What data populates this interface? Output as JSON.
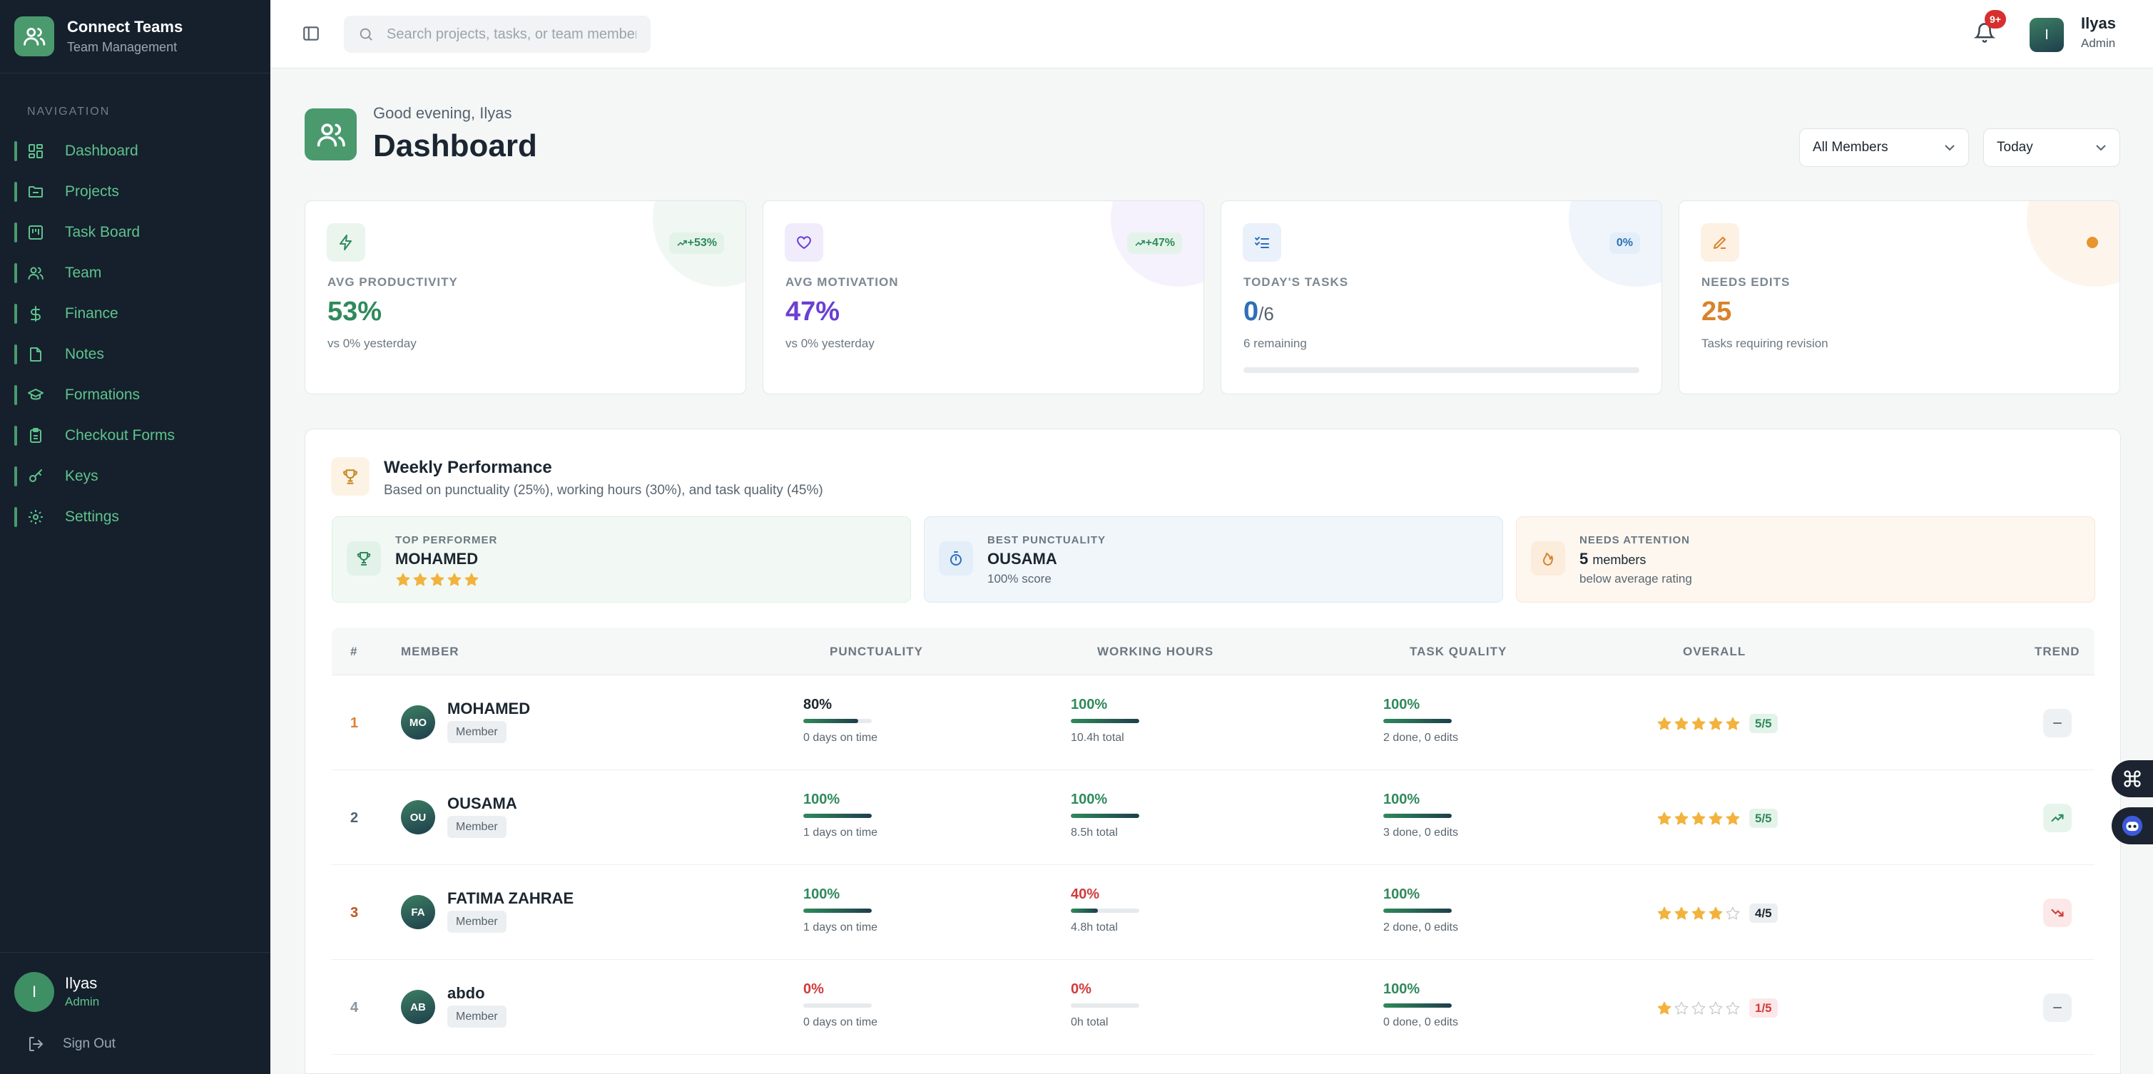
{
  "app": {
    "name": "Connect Teams",
    "subtitle": "Team Management"
  },
  "nav": {
    "heading": "NAVIGATION",
    "items": [
      {
        "label": "Dashboard",
        "icon": "grid-icon"
      },
      {
        "label": "Projects",
        "icon": "folder-icon"
      },
      {
        "label": "Task Board",
        "icon": "kanban-icon"
      },
      {
        "label": "Team",
        "icon": "users-icon"
      },
      {
        "label": "Finance",
        "icon": "dollar-icon"
      },
      {
        "label": "Notes",
        "icon": "file-icon"
      },
      {
        "label": "Formations",
        "icon": "graduation-cap-icon"
      },
      {
        "label": "Checkout Forms",
        "icon": "clipboard-icon"
      },
      {
        "label": "Keys",
        "icon": "key-icon"
      },
      {
        "label": "Settings",
        "icon": "gear-icon"
      }
    ]
  },
  "sidebar_user": {
    "initial": "I",
    "name": "Ilyas",
    "role": "Admin",
    "signout": "Sign Out"
  },
  "topbar": {
    "search_placeholder": "Search projects, tasks, or team members...",
    "notifications_badge": "9+",
    "user_initial": "I",
    "user_name": "Ilyas",
    "user_role": "Admin"
  },
  "header": {
    "greeting": "Good evening, Ilyas",
    "title": "Dashboard",
    "member_filter": "All Members",
    "period_filter": "Today"
  },
  "stats": [
    {
      "label": "AVG PRODUCTIVITY",
      "value": "53%",
      "sub": "vs 0% yesterday",
      "badge": "+53%",
      "color": "#2f8a5b"
    },
    {
      "label": "AVG MOTIVATION",
      "value": "47%",
      "sub": "vs 0% yesterday",
      "badge": "+47%",
      "color": "#6b3fd4"
    },
    {
      "label": "TODAY'S TASKS",
      "value": "0",
      "value_suffix": "/6",
      "sub": "6 remaining",
      "badge": "0%",
      "color": "#2e6fb8",
      "progress": 0
    },
    {
      "label": "NEEDS EDITS",
      "value": "25",
      "sub": "Tasks requiring revision",
      "color": "#d9822b"
    }
  ],
  "weekly": {
    "title": "Weekly Performance",
    "subtitle": "Based on punctuality (25%), working hours (30%), and task quality (45%)",
    "highlights": [
      {
        "label": "TOP PERFORMER",
        "value": "MOHAMED",
        "stars": 5
      },
      {
        "label": "BEST PUNCTUALITY",
        "value": "OUSAMA",
        "sub": "100% score"
      },
      {
        "label": "NEEDS ATTENTION",
        "value": "5",
        "value_suffix": "members",
        "sub": "below average rating"
      }
    ],
    "columns": [
      "#",
      "MEMBER",
      "PUNCTUALITY",
      "WORKING HOURS",
      "TASK QUALITY",
      "OVERALL",
      "TREND"
    ],
    "rows": [
      {
        "rank": "1",
        "initials": "MO",
        "name": "MOHAMED",
        "role": "Member",
        "punctuality": "80%",
        "punctuality_pct": 80,
        "punctuality_sub": "0 days on time",
        "hours": "100%",
        "hours_pct": 100,
        "hours_sub": "10.4h total",
        "quality": "100%",
        "quality_pct": 100,
        "quality_sub": "2 done, 0 edits",
        "stars": 5,
        "rating": "5/5",
        "trend": "flat"
      },
      {
        "rank": "2",
        "initials": "OU",
        "name": "OUSAMA",
        "role": "Member",
        "punctuality": "100%",
        "punctuality_pct": 100,
        "punctuality_sub": "1 days on time",
        "hours": "100%",
        "hours_pct": 100,
        "hours_sub": "8.5h total",
        "quality": "100%",
        "quality_pct": 100,
        "quality_sub": "3 done, 0 edits",
        "stars": 5,
        "rating": "5/5",
        "trend": "up"
      },
      {
        "rank": "3",
        "initials": "FA",
        "name": "FATIMA ZAHRAE",
        "role": "Member",
        "punctuality": "100%",
        "punctuality_pct": 100,
        "punctuality_sub": "1 days on time",
        "hours": "40%",
        "hours_pct": 40,
        "hours_sub": "4.8h total",
        "quality": "100%",
        "quality_pct": 100,
        "quality_sub": "2 done, 0 edits",
        "stars": 4,
        "rating": "4/5",
        "trend": "down"
      },
      {
        "rank": "4",
        "initials": "AB",
        "name": "abdo",
        "role": "Member",
        "punctuality": "0%",
        "punctuality_pct": 0,
        "punctuality_sub": "0 days on time",
        "hours": "0%",
        "hours_pct": 0,
        "hours_sub": "0h total",
        "quality": "100%",
        "quality_pct": 100,
        "quality_sub": "0 done, 0 edits",
        "stars": 1,
        "rating": "1/5",
        "trend": "flat"
      }
    ]
  }
}
